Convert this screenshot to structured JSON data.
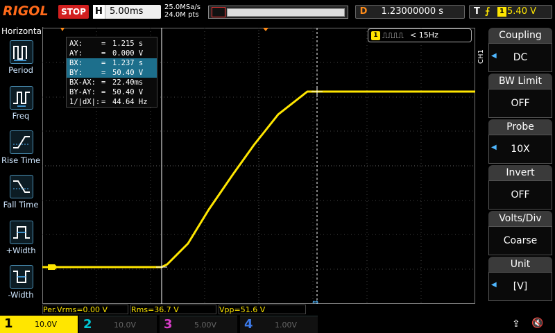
{
  "brand": "RIGOL",
  "run_state": "STOP",
  "horizontal": {
    "label": "H",
    "timebase": "5.00ms"
  },
  "sample": {
    "rate": "25.0MSa/s",
    "points": "24.0M pts"
  },
  "delay": {
    "label": "D",
    "value": "1.23000000 s"
  },
  "trigger": {
    "label": "T",
    "edge_symbol": "⨍",
    "channel": "1",
    "level": "5.40 V"
  },
  "left_menu": {
    "title": "Horizontal",
    "items": [
      {
        "label": "Period",
        "icon": "period-icon"
      },
      {
        "label": "Freq",
        "icon": "freq-icon"
      },
      {
        "label": "Rise Time",
        "icon": "rise-time-icon"
      },
      {
        "label": "Fall Time",
        "icon": "fall-time-icon"
      },
      {
        "label": "+Width",
        "icon": "positive-width-icon"
      },
      {
        "label": "-Width",
        "icon": "negative-width-icon"
      }
    ]
  },
  "cursors": [
    {
      "key": "AX:",
      "value": "1.215 s",
      "highlight": false
    },
    {
      "key": "AY:",
      "value": "0.000 V",
      "highlight": false
    },
    {
      "key": "BX:",
      "value": "1.237 s",
      "highlight": true
    },
    {
      "key": "BY:",
      "value": "50.40 V",
      "highlight": true
    },
    {
      "key": "BX-AX:",
      "value": "22.40ms",
      "highlight": false
    },
    {
      "key": "BY-AY:",
      "value": "50.40 V",
      "highlight": false
    },
    {
      "key": "1/|dX|:",
      "value": "44.64 Hz",
      "highlight": false
    }
  ],
  "freq_counter": {
    "channel": "1",
    "pulse_glyph": "⎍⎍⎍⎍",
    "value": "< 15Hz"
  },
  "channel_menu": {
    "title": "CH1",
    "items": [
      {
        "title": "Coupling",
        "value": "DC",
        "arrow": true
      },
      {
        "title": "BW Limit",
        "value": "OFF",
        "arrow": false
      },
      {
        "title": "Probe",
        "value": "10X",
        "arrow": true
      },
      {
        "title": "Invert",
        "value": "OFF",
        "arrow": false
      },
      {
        "title": "Volts/Div",
        "value": "Coarse",
        "arrow": false
      },
      {
        "title": "Unit",
        "value": "[V]",
        "arrow": true
      }
    ]
  },
  "measurements": [
    {
      "text": "Per.Vrms=0.00 V"
    },
    {
      "text": "Rms=36.7 V"
    },
    {
      "text": "Vpp=51.6 V"
    }
  ],
  "channels": [
    {
      "num": "1",
      "scale": "10.0V",
      "color": "#ffe600",
      "active": true
    },
    {
      "num": "2",
      "scale": "10.0V",
      "color": "#00c8d6",
      "active": false
    },
    {
      "num": "3",
      "scale": "5.00V",
      "color": "#d93cc8",
      "active": false
    },
    {
      "num": "4",
      "scale": "1.00V",
      "color": "#3d7ae8",
      "active": false
    }
  ],
  "colors": {
    "ch1": "#ffe600",
    "accent": "#ff8c1a",
    "stop": "#d21f1f"
  }
}
